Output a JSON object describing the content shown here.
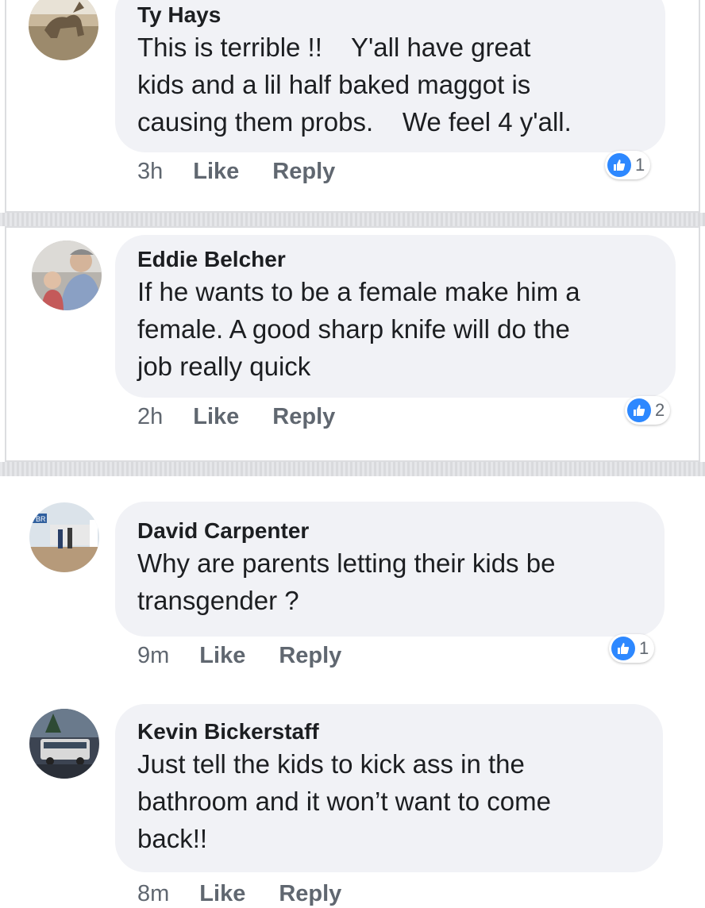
{
  "comments": [
    {
      "name": "Ty Hays",
      "lines": [
        "This is terrible !!    Y'all have great",
        "kids and a lil half baked maggot is",
        "causing them probs.    We feel 4 y'all."
      ],
      "time": "3h",
      "like_label": "Like",
      "reply_label": "Reply",
      "reaction_count": "1",
      "avatar_icon": "horse-photo-avatar-icon"
    },
    {
      "name": "Eddie Belcher",
      "lines": [
        "If he wants to be a female make him a",
        "female. A good sharp knife will do the",
        "job really quick"
      ],
      "time": "2h",
      "like_label": "Like",
      "reply_label": "Reply",
      "reaction_count": "2",
      "avatar_icon": "man-with-child-avatar-icon"
    },
    {
      "name": "David Carpenter",
      "lines": [
        "Why are parents letting their kids be",
        "transgender ?"
      ],
      "time": "9m",
      "like_label": "Like",
      "reply_label": "Reply",
      "reaction_count": "1",
      "avatar_icon": "rodeo-photo-avatar-icon",
      "avatar_sign_text": "YBR"
    },
    {
      "name": "Kevin Bickerstaff",
      "lines": [
        "Just tell the kids to kick ass in the",
        "bathroom and it won’t want to come",
        "back!!"
      ],
      "time": "8m",
      "like_label": "Like",
      "reply_label": "Reply",
      "avatar_icon": "bus-photo-avatar-icon"
    }
  ],
  "colors": {
    "bubble": "#f1f2f6",
    "like_blue": "#2d88ff",
    "meta_gray": "#606770",
    "text": "#1c1e21"
  }
}
